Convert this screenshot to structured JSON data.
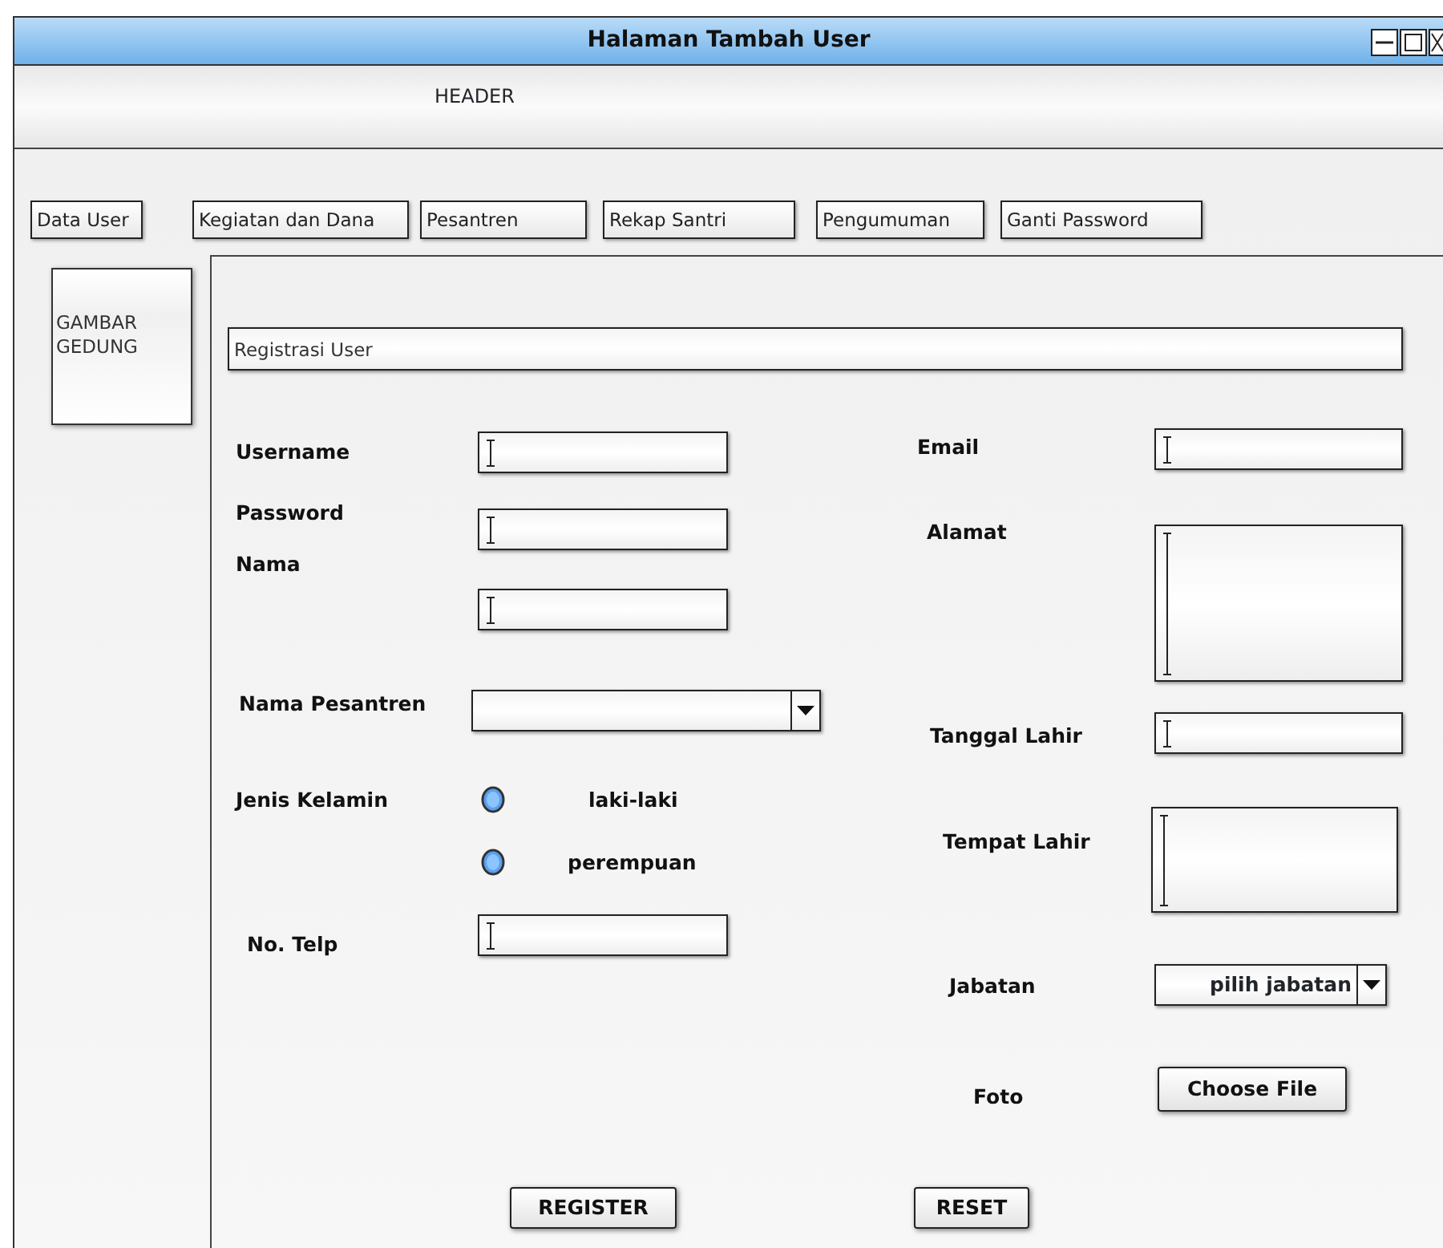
{
  "window": {
    "title": "Halaman Tambah User"
  },
  "header": "HEADER",
  "nav_tabs": [
    {
      "label": "Data User"
    },
    {
      "label": "Kegiatan dan Dana"
    },
    {
      "label": "Pesantren"
    },
    {
      "label": "Rekap Santri"
    },
    {
      "label": "Pengumuman"
    },
    {
      "label": "Ganti Password"
    }
  ],
  "sidebar": {
    "image_label": "GAMBAR GEDUNG"
  },
  "form": {
    "title": "Registrasi User",
    "fields": [
      {
        "kind": "text",
        "label": "Username"
      },
      {
        "kind": "text",
        "label": "Password"
      },
      {
        "kind": "text",
        "label": "Nama"
      },
      {
        "kind": "select",
        "label": "Nama Pesantren"
      },
      {
        "kind": "radio",
        "label": "Jenis Kelamin",
        "options": [
          {
            "label": "laki-laki",
            "selected": false
          },
          {
            "label": "perempuan",
            "selected": false
          }
        ]
      },
      {
        "kind": "text",
        "label": "No. Telp"
      },
      {
        "kind": "text",
        "label": "Email"
      },
      {
        "kind": "textarea",
        "label": "Alamat"
      },
      {
        "kind": "text",
        "label": "Tanggal Lahir"
      },
      {
        "kind": "textarea",
        "label": "Tempat Lahir"
      },
      {
        "kind": "select",
        "label": "Jabatan",
        "value": "pilih jabatan"
      },
      {
        "kind": "file",
        "label": "Foto",
        "button": "Choose File"
      }
    ],
    "buttons": [
      "REGISTER",
      "RESET"
    ]
  }
}
